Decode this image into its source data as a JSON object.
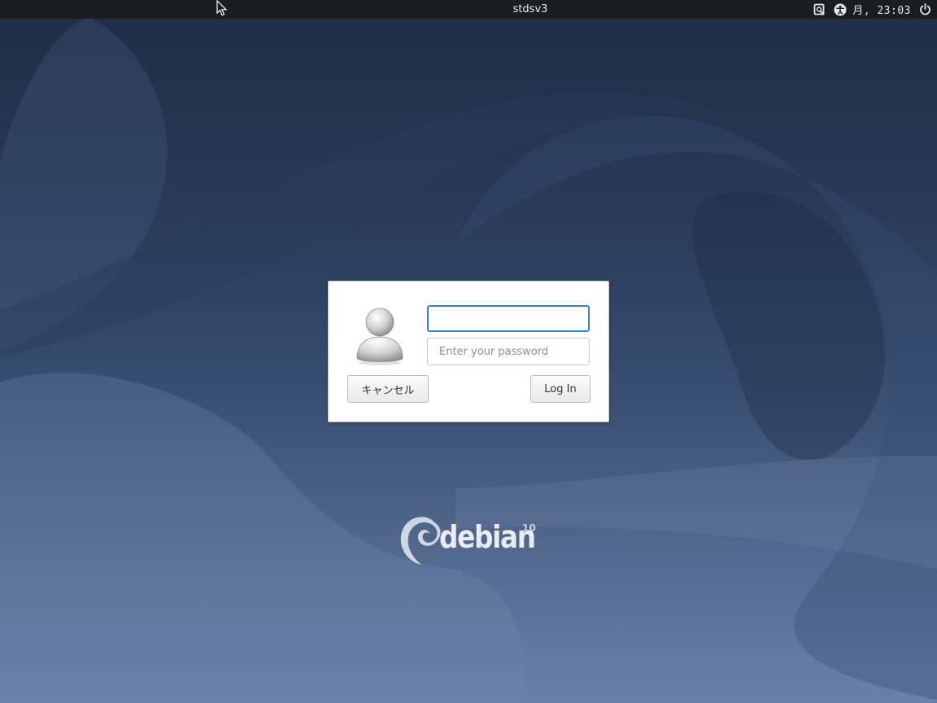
{
  "top_bar": {
    "host_name": "stdsv3",
    "clock": "月, 23:03",
    "icons": [
      "screen-reader-icon",
      "accessibility-icon",
      "power-icon"
    ]
  },
  "login_dialog": {
    "username_value": "",
    "password_placeholder": "Enter your password",
    "cancel_label": "キャンセル",
    "login_label": "Log In",
    "focus_color": "#3584c4"
  },
  "branding": {
    "logo_text": "debian",
    "logo_version": "10"
  },
  "colors": {
    "top_bar_bg": "#1b1d21",
    "wallpaper_top": "#1f2c44",
    "wallpaper_bottom": "#6a80a8"
  }
}
